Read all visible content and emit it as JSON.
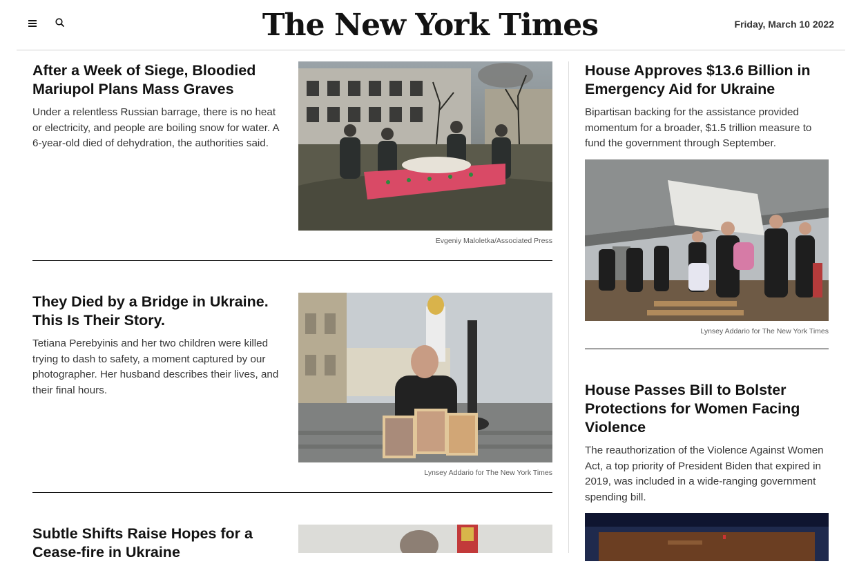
{
  "header": {
    "logo_text": "The New York Times",
    "date": "Friday, March 10 2022"
  },
  "left_stories": [
    {
      "headline": "After a Week of Siege, Bloodied Mariupol Plans Mass Graves",
      "summary": "Under a relentless Russian barrage, there is no heat or electricity, and people are boiling snow for water. A 6-year-old died of dehydration, the authorities said.",
      "credit": "Evgeniy Maloletka/Associated Press"
    },
    {
      "headline": "They Died by a Bridge in Ukraine. This Is Their Story.",
      "summary": "Tetiana Perebyinis and her two children were killed trying to dash to safety, a moment captured by our photographer. Her husband describes their lives, and their final hours.",
      "credit": "Lynsey Addario for The New York Times"
    },
    {
      "headline": "Subtle Shifts Raise Hopes for a Cease-fire in Ukraine"
    }
  ],
  "right_stories": [
    {
      "headline": "House Approves $13.6 Billion in Emergency Aid for Ukraine",
      "summary": "Bipartisan backing for the assistance provided momentum for a broader, $1.5 trillion measure to fund the government through September.",
      "credit": "Lynsey Addario for The New York Times"
    },
    {
      "headline": "House Passes Bill to Bolster Protections for Women Facing Violence",
      "summary": "The reauthorization of the Violence Against Women Act, a top priority of President Biden that expired in 2019, was included in a wide-ranging government spending bill."
    }
  ]
}
